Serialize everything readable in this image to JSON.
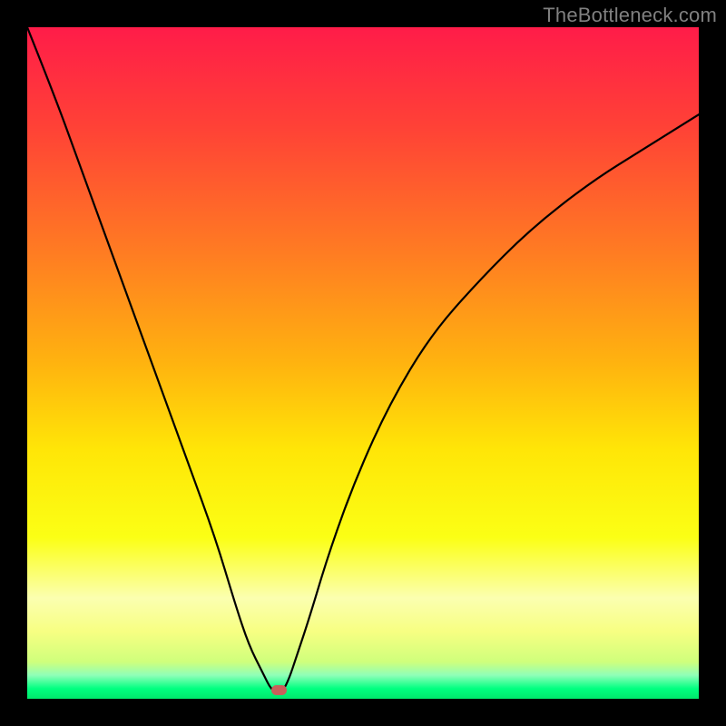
{
  "watermark": "TheBottleneck.com",
  "chart_data": {
    "type": "line",
    "title": "",
    "xlabel": "",
    "ylabel": "",
    "xlim": [
      0,
      100
    ],
    "ylim": [
      0,
      100
    ],
    "gradient_stops": [
      {
        "offset": 0.0,
        "color": "#ff1c49"
      },
      {
        "offset": 0.15,
        "color": "#ff4236"
      },
      {
        "offset": 0.33,
        "color": "#ff7a23"
      },
      {
        "offset": 0.5,
        "color": "#ffb30f"
      },
      {
        "offset": 0.63,
        "color": "#ffe607"
      },
      {
        "offset": 0.76,
        "color": "#fbff15"
      },
      {
        "offset": 0.85,
        "color": "#fbffb0"
      },
      {
        "offset": 0.9,
        "color": "#f7ff82"
      },
      {
        "offset": 0.945,
        "color": "#cfff7c"
      },
      {
        "offset": 0.965,
        "color": "#8fffb8"
      },
      {
        "offset": 0.985,
        "color": "#00ff80"
      },
      {
        "offset": 1.0,
        "color": "#00e86b"
      }
    ],
    "series": [
      {
        "name": "bottleneck-curve",
        "x": [
          0,
          4,
          8,
          12,
          16,
          20,
          24,
          28,
          31,
          33,
          35,
          36.5,
          38,
          39,
          40,
          42,
          45,
          49,
          54,
          60,
          67,
          75,
          84,
          92,
          100
        ],
        "values": [
          100,
          90,
          79,
          68,
          57,
          46,
          35,
          24,
          14,
          8,
          4,
          1,
          1,
          3,
          6,
          12,
          22,
          33,
          44,
          54,
          62,
          70,
          77,
          82,
          87
        ]
      }
    ],
    "marker": {
      "x": 37.5,
      "y": 1.3,
      "w": 2.2,
      "h": 1.4,
      "color": "#c9605a"
    }
  }
}
